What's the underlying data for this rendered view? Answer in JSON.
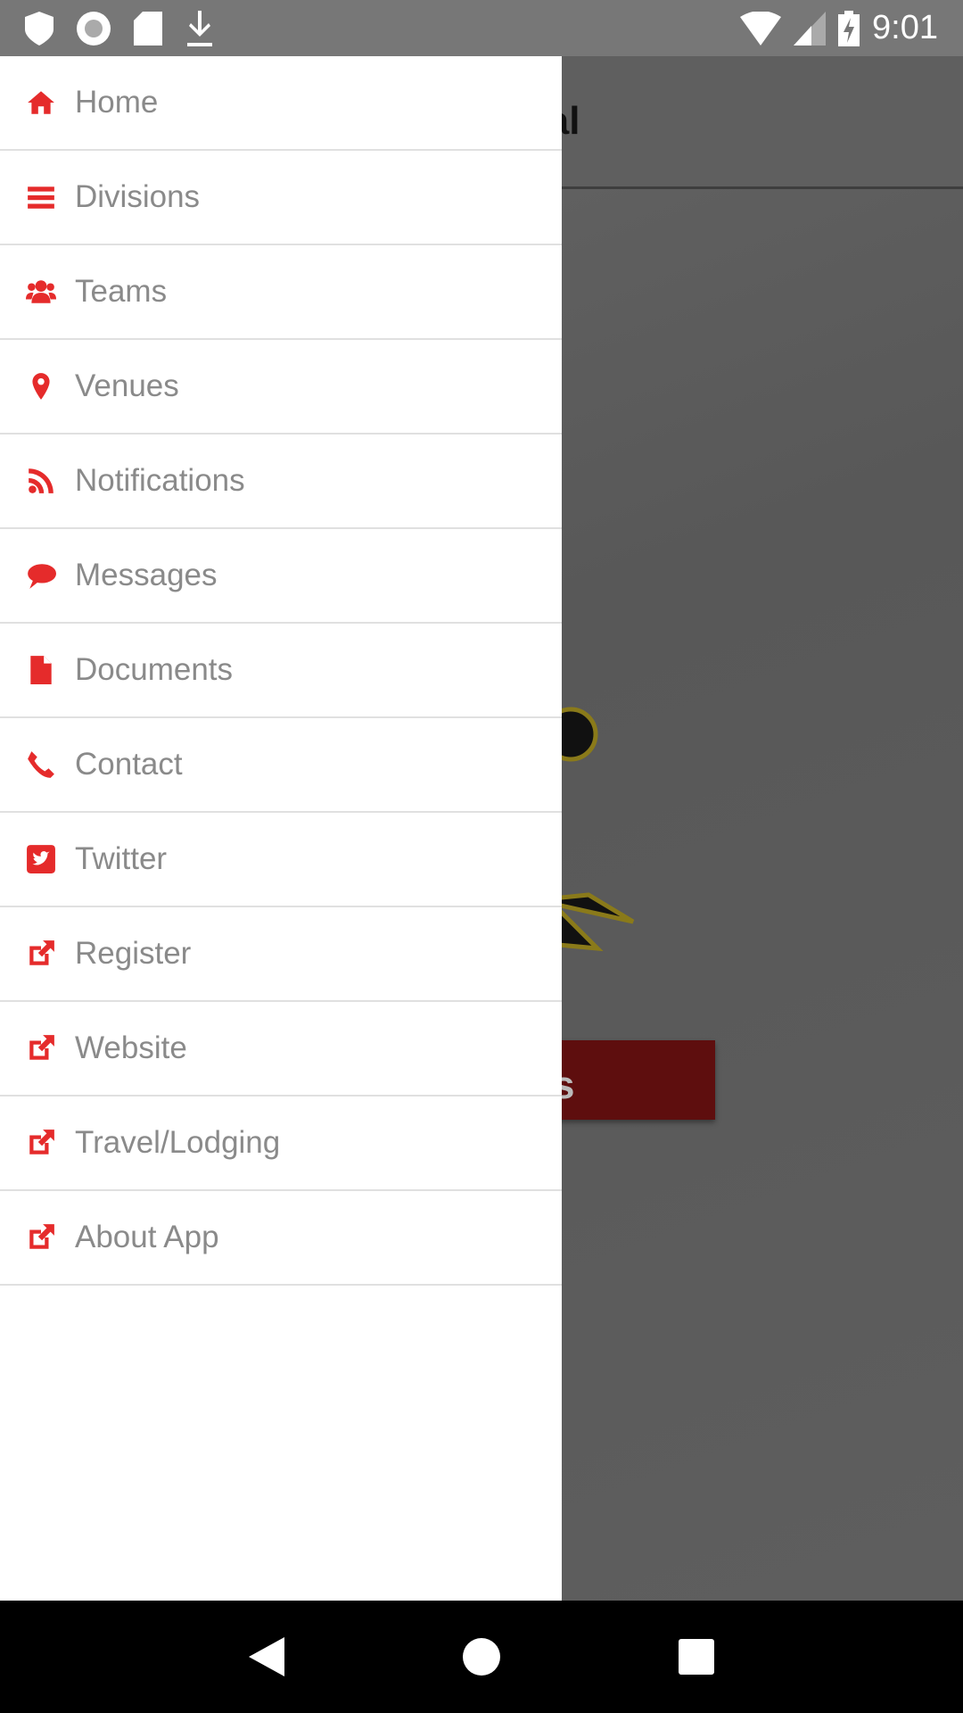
{
  "status_bar": {
    "time": "9:01",
    "icons": [
      "shield-icon",
      "record-icon",
      "sd-card-icon",
      "download-icon",
      "wifi-icon",
      "signal-icon",
      "battery-charging-icon"
    ]
  },
  "background": {
    "app_title_partial": "onal",
    "button_partial": "s"
  },
  "drawer": {
    "items": [
      {
        "label": "Home",
        "icon": "home-icon"
      },
      {
        "label": "Divisions",
        "icon": "list-icon"
      },
      {
        "label": "Teams",
        "icon": "users-icon"
      },
      {
        "label": "Venues",
        "icon": "map-marker-icon"
      },
      {
        "label": "Notifications",
        "icon": "rss-icon"
      },
      {
        "label": "Messages",
        "icon": "comment-icon"
      },
      {
        "label": "Documents",
        "icon": "file-icon"
      },
      {
        "label": "Contact",
        "icon": "phone-icon"
      },
      {
        "label": "Twitter",
        "icon": "twitter-square-icon"
      },
      {
        "label": "Register",
        "icon": "external-link-icon"
      },
      {
        "label": "Website",
        "icon": "external-link-icon"
      },
      {
        "label": "Travel/Lodging",
        "icon": "external-link-icon"
      },
      {
        "label": "About App",
        "icon": "external-link-icon"
      }
    ]
  },
  "colors": {
    "accent": "#e52b2b",
    "label": "#8a8a8a"
  }
}
